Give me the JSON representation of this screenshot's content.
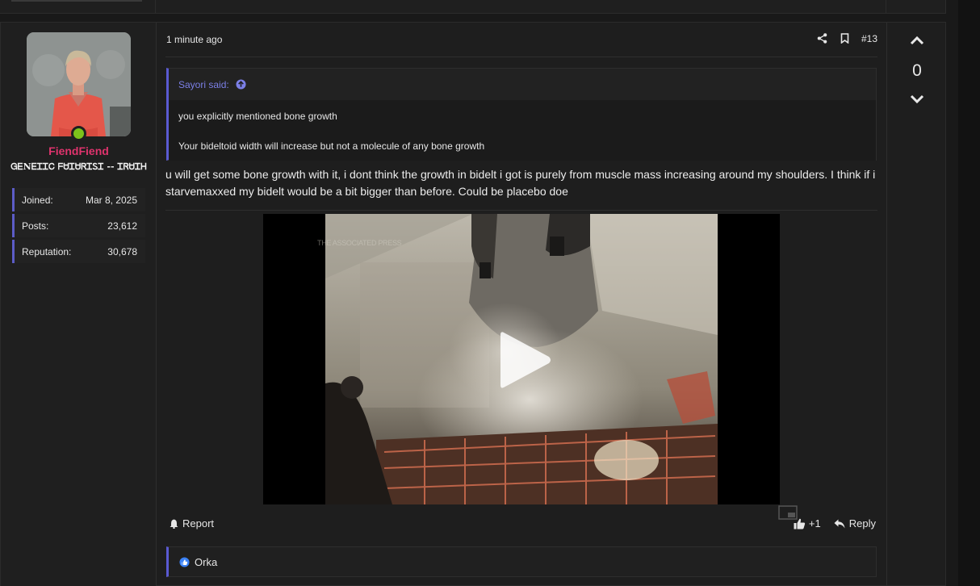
{
  "colors": {
    "accent": "#5a5ad2",
    "username": "#e0336d",
    "online": "#7cc21b",
    "quote_author": "#7b7fe6",
    "like": "#3b82f6"
  },
  "user": {
    "name": "FiendFiend",
    "title": "ᏀᎬΝᎬᏆᏆᏟ ᖴᏌᏆᏌᏒᏆᏚᏆ -- ᏆᏒᏌᏆᎻ",
    "stats": [
      {
        "label": "Joined:",
        "value": "Mar 8, 2025"
      },
      {
        "label": "Posts:",
        "value": "23,612"
      },
      {
        "label": "Reputation:",
        "value": "30,678"
      }
    ]
  },
  "post": {
    "time": "1 minute ago",
    "number": "#13",
    "quote": {
      "author": "Sayori said:",
      "lines": [
        "you explicitly mentioned bone growth",
        "Your bideltoid width will increase but not a molecule of any bone growth"
      ]
    },
    "message": "u will get some bone growth with it, i dont think the growth in bidelt i got is purely from muscle mass increasing around my shoulders. I think if i starvemaxxed my bidelt would be a bit bigger than before. Could be placebo doe",
    "video": {
      "watermark": "THE ASSOCIATED PRESS"
    },
    "footer": {
      "report": "Report",
      "like_count": "+1",
      "reply": "Reply"
    },
    "reactions": {
      "user": "Orka"
    }
  },
  "vote": {
    "count": "0"
  },
  "icons": [
    "share-icon",
    "bookmark-icon",
    "arrow-up-circle-icon",
    "bell-icon",
    "thumbs-up-icon",
    "reply-icon",
    "like-reaction-icon",
    "chevron-up-icon",
    "chevron-down-icon",
    "play-icon",
    "picture-in-picture-icon"
  ]
}
